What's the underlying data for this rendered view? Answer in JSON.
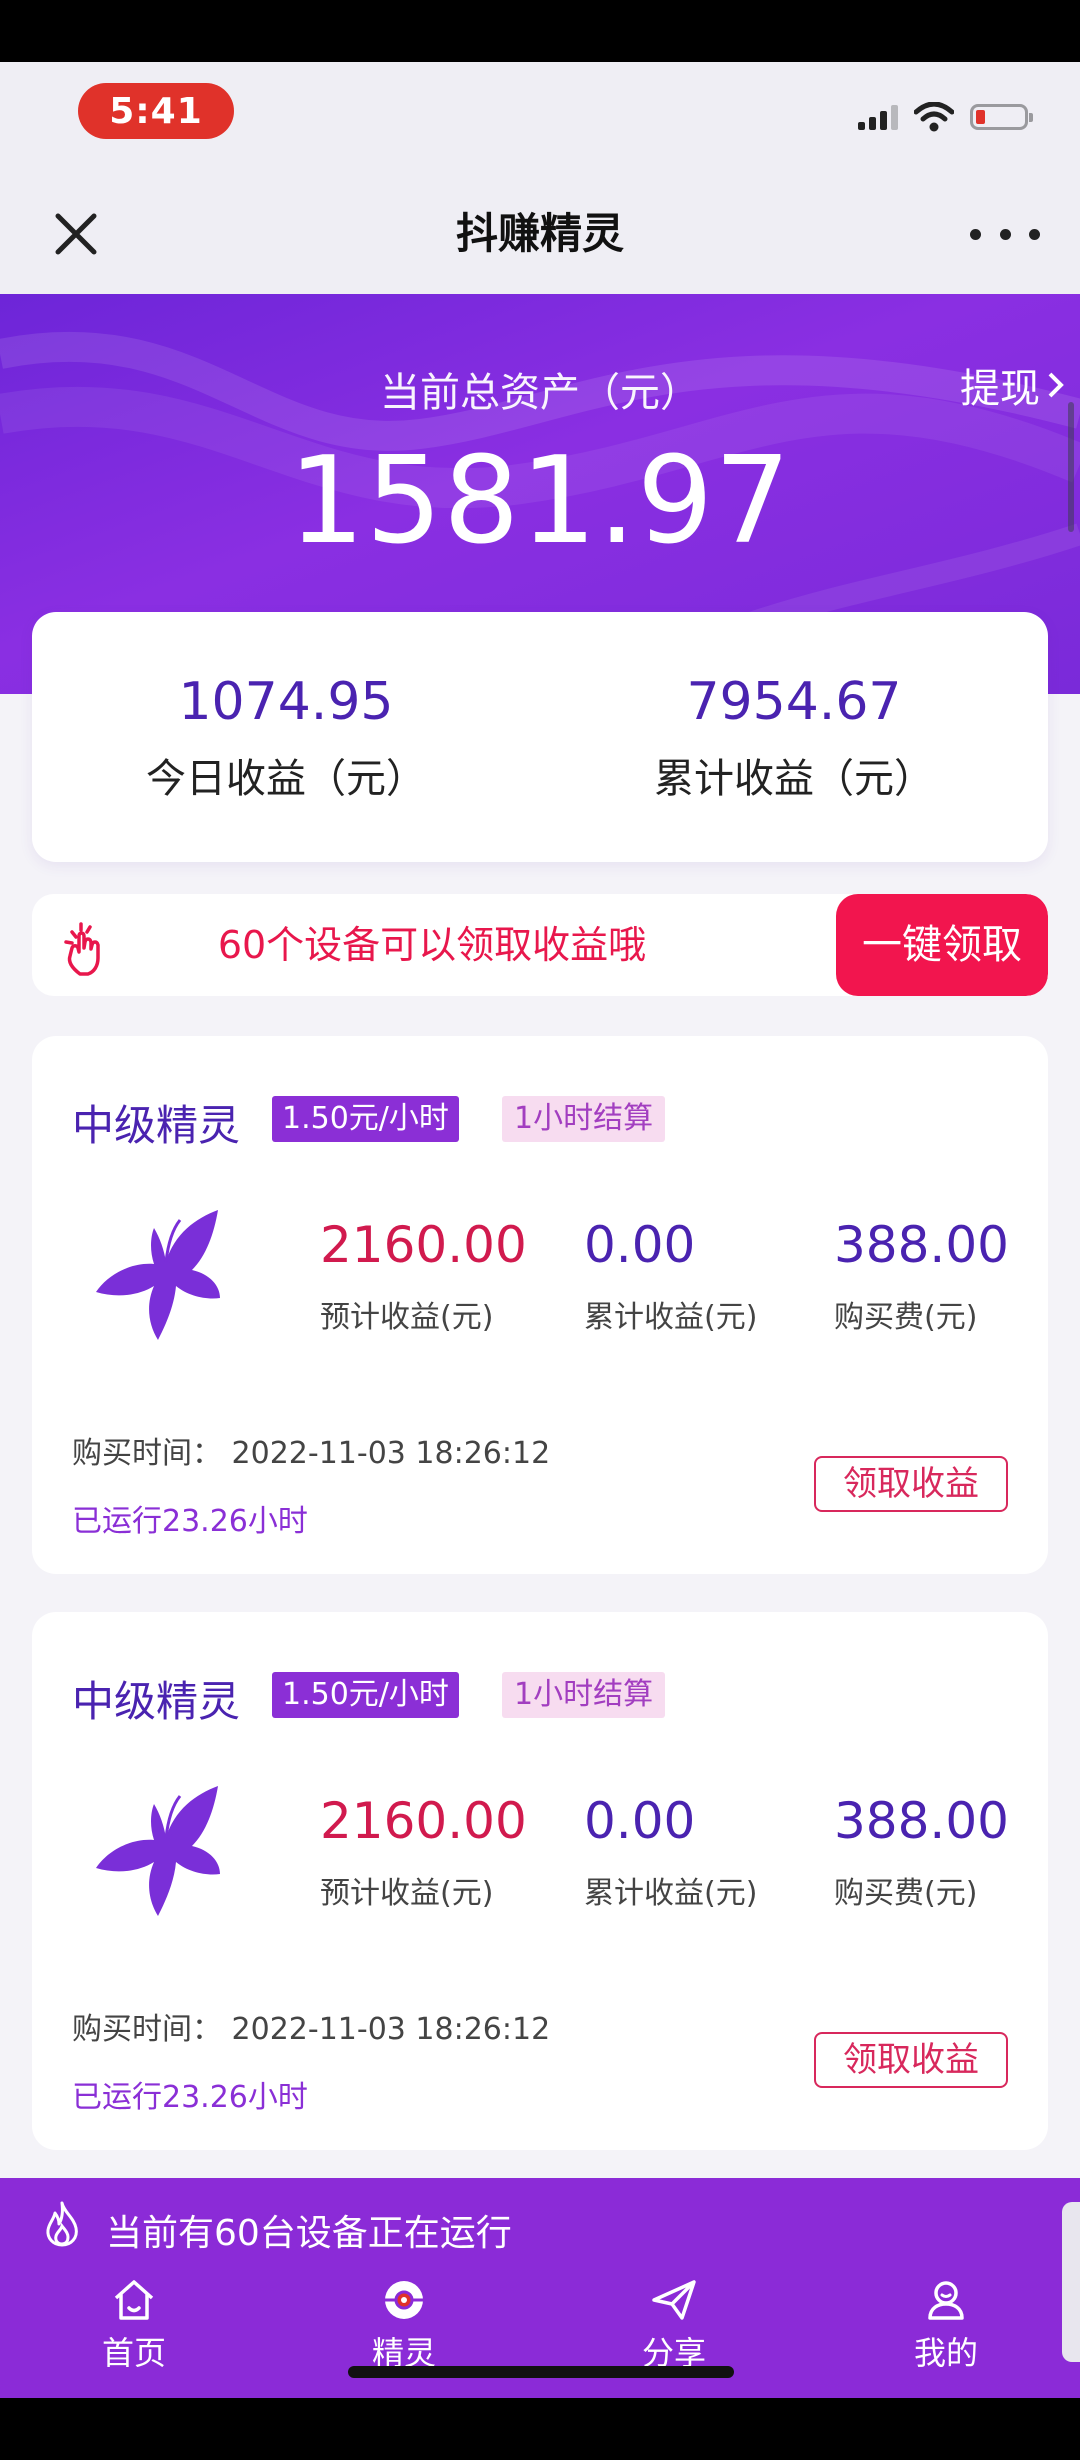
{
  "status_bar": {
    "time": "5:41"
  },
  "navbar": {
    "title": "抖赚精灵"
  },
  "hero": {
    "label": "当前总资产（元）",
    "amount": "1581.97",
    "withdraw_label": "提现"
  },
  "earnings": {
    "today": {
      "value": "1074.95",
      "label": "今日收益（元）"
    },
    "total": {
      "value": "7954.67",
      "label": "累计收益（元）"
    }
  },
  "claim_bar": {
    "text": "60个设备可以领取收益哦",
    "button": "一键领取"
  },
  "devices": [
    {
      "title": "中级精灵",
      "rate_tag": "1.50元/小时",
      "settle_tag": "1小时结算",
      "expected": {
        "value": "2160.00",
        "label": "预计收益(元)"
      },
      "accumulated": {
        "value": "0.00",
        "label": "累计收益(元)"
      },
      "price": {
        "value": "388.00",
        "label": "购买费(元)"
      },
      "buy_time": "购买时间：  2022-11-03 18:26:12",
      "running": "已运行23.26小时",
      "claim_button": "领取收益"
    },
    {
      "title": "中级精灵",
      "rate_tag": "1.50元/小时",
      "settle_tag": "1小时结算",
      "expected": {
        "value": "2160.00",
        "label": "预计收益(元)"
      },
      "accumulated": {
        "value": "0.00",
        "label": "累计收益(元)"
      },
      "price": {
        "value": "388.00",
        "label": "购买费(元)"
      },
      "buy_time": "购买时间：  2022-11-03 18:26:12",
      "running": "已运行23.26小时",
      "claim_button": "领取收益"
    }
  ],
  "running_notice": "当前有60台设备正在运行",
  "tabbar": [
    {
      "label": "首页",
      "icon": "home-icon"
    },
    {
      "label": "精灵",
      "icon": "sprite-ball-icon"
    },
    {
      "label": "分享",
      "icon": "paper-plane-icon"
    },
    {
      "label": "我的",
      "icon": "profile-icon"
    }
  ],
  "colors": {
    "brand_purple": "#8b2bd7",
    "accent_pink": "#f2154e",
    "number_purple": "#4a23b0",
    "time_pill": "#e0322a"
  }
}
